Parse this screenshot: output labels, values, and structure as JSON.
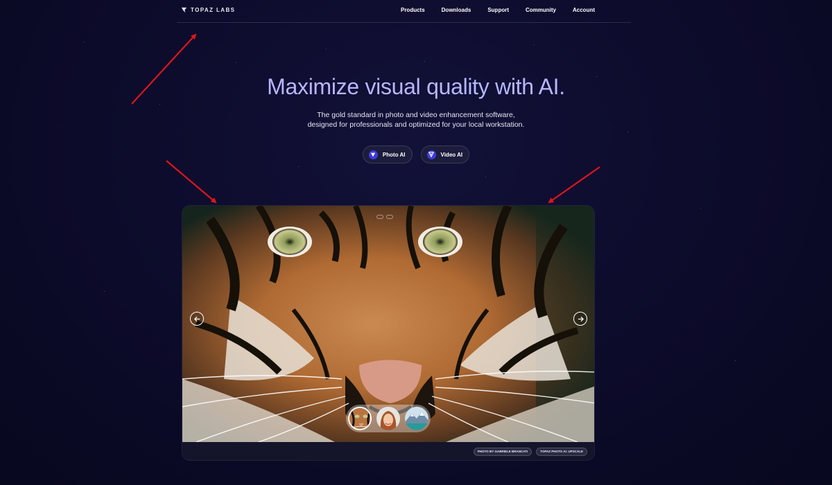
{
  "header": {
    "logo_text": "TOPAZ LABS",
    "nav": [
      "Products",
      "Downloads",
      "Support",
      "Community",
      "Account"
    ]
  },
  "hero": {
    "title": "Maximize visual quality with AI.",
    "subtitle_line1": "The gold standard in photo and video enhancement software,",
    "subtitle_line2": "designed for professionals and optimized for your local workstation.",
    "buttons": [
      {
        "label": "Photo AI",
        "icon": "photo-ai-icon"
      },
      {
        "label": "Video AI",
        "icon": "video-ai-icon"
      }
    ]
  },
  "showcase": {
    "thumbnails": [
      "tiger",
      "portrait",
      "landscape"
    ],
    "active_thumbnail": 0,
    "tags": [
      "PHOTO BY GABRIELE BRANCATI",
      "TOPAZ PHOTO AI: UPSCALE"
    ]
  },
  "colors": {
    "background": "#0c0b2a",
    "title": "#b7b6ff",
    "accent": "#3e3ae0",
    "annotation_arrow": "#e0151b"
  }
}
